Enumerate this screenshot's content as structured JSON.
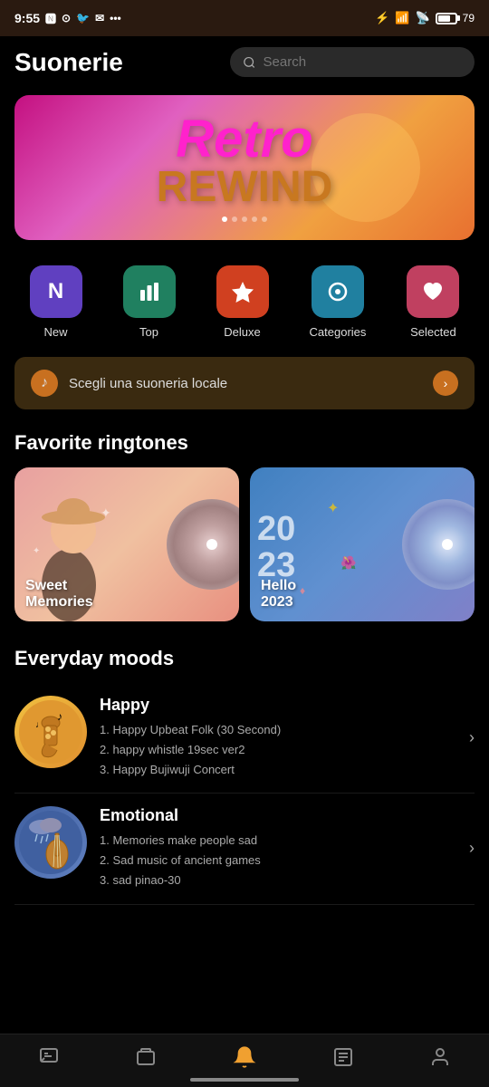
{
  "statusBar": {
    "time": "9:55",
    "battery": "79",
    "icons": [
      "signal",
      "wifi",
      "bluetooth"
    ]
  },
  "header": {
    "title": "Suonerie",
    "searchPlaceholder": "Search"
  },
  "banner": {
    "line1": "Retro",
    "line2": "REWIND",
    "dots": 5,
    "activeDot": 0
  },
  "categories": [
    {
      "id": "new",
      "label": "New",
      "icon": "N",
      "color": "#6040c0"
    },
    {
      "id": "top",
      "label": "Top",
      "icon": "📊",
      "color": "#208060"
    },
    {
      "id": "deluxe",
      "label": "Deluxe",
      "icon": "⭐",
      "color": "#d04020"
    },
    {
      "id": "categories",
      "label": "Categories",
      "icon": "👁",
      "color": "#2080a0"
    },
    {
      "id": "selected",
      "label": "Selected",
      "icon": "❤",
      "color": "#c04060"
    }
  ],
  "localBanner": {
    "text": "Scegli una suoneria locale",
    "icon": "♪"
  },
  "favoritesSection": {
    "title": "Favorite ringtones",
    "items": [
      {
        "id": "sweet",
        "label": "Sweet\nMemories"
      },
      {
        "id": "hello",
        "label": "Hello\n2023"
      }
    ]
  },
  "moodsSection": {
    "title": "Everyday moods",
    "items": [
      {
        "id": "happy",
        "title": "Happy",
        "tracks": [
          "1. Happy Upbeat Folk (30 Second)",
          "2. happy whistle 19sec ver2",
          "3. Happy Bujiwuji Concert"
        ]
      },
      {
        "id": "emotional",
        "title": "Emotional",
        "tracks": [
          "1. Memories make people sad",
          "2. Sad music of ancient games",
          "3. sad pinao-30"
        ]
      }
    ]
  },
  "bottomNav": [
    {
      "id": "chat",
      "icon": "💬",
      "active": false
    },
    {
      "id": "cards",
      "icon": "🎴",
      "active": false
    },
    {
      "id": "bell",
      "icon": "🔔",
      "active": true
    },
    {
      "id": "text",
      "icon": "🔤",
      "active": false
    },
    {
      "id": "user",
      "icon": "👤",
      "active": false
    }
  ]
}
